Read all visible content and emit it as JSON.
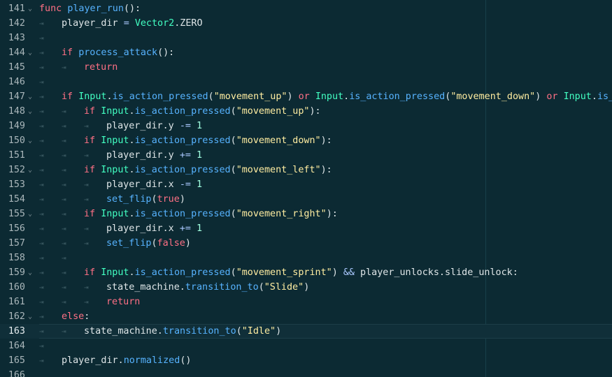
{
  "editor": {
    "lines": [
      {
        "num": "141",
        "fold": true,
        "indent": 0,
        "tokens": [
          {
            "t": "func",
            "c": "kw"
          },
          {
            "t": " "
          },
          {
            "t": "player_run",
            "c": "fn"
          },
          {
            "t": "():"
          }
        ]
      },
      {
        "num": "142",
        "fold": false,
        "indent": 1,
        "tokens": [
          {
            "t": "player_dir "
          },
          {
            "t": "=",
            "c": "op"
          },
          {
            "t": " "
          },
          {
            "t": "Vector2",
            "c": "cls"
          },
          {
            "t": ".ZERO"
          }
        ]
      },
      {
        "num": "143",
        "fold": false,
        "indent": 1,
        "tokens": []
      },
      {
        "num": "144",
        "fold": true,
        "indent": 1,
        "tokens": [
          {
            "t": "if",
            "c": "kw"
          },
          {
            "t": " "
          },
          {
            "t": "process_attack",
            "c": "fn"
          },
          {
            "t": "():"
          }
        ]
      },
      {
        "num": "145",
        "fold": false,
        "indent": 2,
        "tokens": [
          {
            "t": "return",
            "c": "kw"
          }
        ]
      },
      {
        "num": "146",
        "fold": false,
        "indent": 1,
        "tokens": []
      },
      {
        "num": "147",
        "fold": true,
        "indent": 1,
        "tokens": [
          {
            "t": "if",
            "c": "kw"
          },
          {
            "t": " "
          },
          {
            "t": "Input",
            "c": "cls"
          },
          {
            "t": "."
          },
          {
            "t": "is_action_pressed",
            "c": "fn"
          },
          {
            "t": "("
          },
          {
            "t": "\"movement_up\"",
            "c": "str"
          },
          {
            "t": ") "
          },
          {
            "t": "or",
            "c": "kw"
          },
          {
            "t": " "
          },
          {
            "t": "Input",
            "c": "cls"
          },
          {
            "t": "."
          },
          {
            "t": "is_action_pressed",
            "c": "fn"
          },
          {
            "t": "("
          },
          {
            "t": "\"movement_down\"",
            "c": "str"
          },
          {
            "t": ") "
          },
          {
            "t": "or",
            "c": "kw"
          },
          {
            "t": " "
          },
          {
            "t": "Input",
            "c": "cls"
          },
          {
            "t": "."
          },
          {
            "t": "is_a",
            "c": "fn"
          }
        ]
      },
      {
        "num": "148",
        "fold": true,
        "indent": 2,
        "tokens": [
          {
            "t": "if",
            "c": "kw"
          },
          {
            "t": " "
          },
          {
            "t": "Input",
            "c": "cls"
          },
          {
            "t": "."
          },
          {
            "t": "is_action_pressed",
            "c": "fn"
          },
          {
            "t": "("
          },
          {
            "t": "\"movement_up\"",
            "c": "str"
          },
          {
            "t": "):"
          }
        ]
      },
      {
        "num": "149",
        "fold": false,
        "indent": 3,
        "tokens": [
          {
            "t": "player_dir.y "
          },
          {
            "t": "-=",
            "c": "op"
          },
          {
            "t": " "
          },
          {
            "t": "1",
            "c": "num"
          }
        ]
      },
      {
        "num": "150",
        "fold": true,
        "indent": 2,
        "tokens": [
          {
            "t": "if",
            "c": "kw"
          },
          {
            "t": " "
          },
          {
            "t": "Input",
            "c": "cls"
          },
          {
            "t": "."
          },
          {
            "t": "is_action_pressed",
            "c": "fn"
          },
          {
            "t": "("
          },
          {
            "t": "\"movement_down\"",
            "c": "str"
          },
          {
            "t": "):"
          }
        ]
      },
      {
        "num": "151",
        "fold": false,
        "indent": 3,
        "tokens": [
          {
            "t": "player_dir.y "
          },
          {
            "t": "+=",
            "c": "op"
          },
          {
            "t": " "
          },
          {
            "t": "1",
            "c": "num"
          }
        ]
      },
      {
        "num": "152",
        "fold": true,
        "indent": 2,
        "tokens": [
          {
            "t": "if",
            "c": "kw"
          },
          {
            "t": " "
          },
          {
            "t": "Input",
            "c": "cls"
          },
          {
            "t": "."
          },
          {
            "t": "is_action_pressed",
            "c": "fn"
          },
          {
            "t": "("
          },
          {
            "t": "\"movement_left\"",
            "c": "str"
          },
          {
            "t": "):"
          }
        ]
      },
      {
        "num": "153",
        "fold": false,
        "indent": 3,
        "tokens": [
          {
            "t": "player_dir.x "
          },
          {
            "t": "-=",
            "c": "op"
          },
          {
            "t": " "
          },
          {
            "t": "1",
            "c": "num"
          }
        ]
      },
      {
        "num": "154",
        "fold": false,
        "indent": 3,
        "tokens": [
          {
            "t": "set_flip",
            "c": "fn"
          },
          {
            "t": "("
          },
          {
            "t": "true",
            "c": "kw"
          },
          {
            "t": ")"
          }
        ]
      },
      {
        "num": "155",
        "fold": true,
        "indent": 2,
        "tokens": [
          {
            "t": "if",
            "c": "kw"
          },
          {
            "t": " "
          },
          {
            "t": "Input",
            "c": "cls"
          },
          {
            "t": "."
          },
          {
            "t": "is_action_pressed",
            "c": "fn"
          },
          {
            "t": "("
          },
          {
            "t": "\"movement_right\"",
            "c": "str"
          },
          {
            "t": "):"
          }
        ]
      },
      {
        "num": "156",
        "fold": false,
        "indent": 3,
        "tokens": [
          {
            "t": "player_dir.x "
          },
          {
            "t": "+=",
            "c": "op"
          },
          {
            "t": " "
          },
          {
            "t": "1",
            "c": "num"
          }
        ]
      },
      {
        "num": "157",
        "fold": false,
        "indent": 3,
        "tokens": [
          {
            "t": "set_flip",
            "c": "fn"
          },
          {
            "t": "("
          },
          {
            "t": "false",
            "c": "kw"
          },
          {
            "t": ")"
          }
        ]
      },
      {
        "num": "158",
        "fold": false,
        "indent": 2,
        "tokens": []
      },
      {
        "num": "159",
        "fold": true,
        "indent": 2,
        "tokens": [
          {
            "t": "if",
            "c": "kw"
          },
          {
            "t": " "
          },
          {
            "t": "Input",
            "c": "cls"
          },
          {
            "t": "."
          },
          {
            "t": "is_action_pressed",
            "c": "fn"
          },
          {
            "t": "("
          },
          {
            "t": "\"movement_sprint\"",
            "c": "str"
          },
          {
            "t": ") "
          },
          {
            "t": "&&",
            "c": "op"
          },
          {
            "t": " player_unlocks.slide_unlock:"
          }
        ]
      },
      {
        "num": "160",
        "fold": false,
        "indent": 3,
        "tokens": [
          {
            "t": "state_machine."
          },
          {
            "t": "transition_to",
            "c": "fn"
          },
          {
            "t": "("
          },
          {
            "t": "\"Slide\"",
            "c": "str"
          },
          {
            "t": ")"
          }
        ]
      },
      {
        "num": "161",
        "fold": false,
        "indent": 3,
        "tokens": [
          {
            "t": "return",
            "c": "kw"
          }
        ]
      },
      {
        "num": "162",
        "fold": true,
        "indent": 1,
        "tokens": [
          {
            "t": "else",
            "c": "kw"
          },
          {
            "t": ":"
          }
        ]
      },
      {
        "num": "163",
        "fold": false,
        "indent": 2,
        "current": true,
        "tokens": [
          {
            "t": "state_machine."
          },
          {
            "t": "transition_to",
            "c": "fn"
          },
          {
            "t": "("
          },
          {
            "t": "\"Idle\"",
            "c": "str"
          },
          {
            "t": ")"
          }
        ]
      },
      {
        "num": "164",
        "fold": false,
        "indent": 1,
        "tokens": []
      },
      {
        "num": "165",
        "fold": false,
        "indent": 1,
        "tokens": [
          {
            "t": "player_dir."
          },
          {
            "t": "normalized",
            "c": "fn"
          },
          {
            "t": "()"
          }
        ]
      },
      {
        "num": "166",
        "fold": false,
        "indent": 0,
        "tokens": []
      }
    ]
  },
  "glyphs": {
    "tab": "⇥",
    "fold": "⌄"
  }
}
